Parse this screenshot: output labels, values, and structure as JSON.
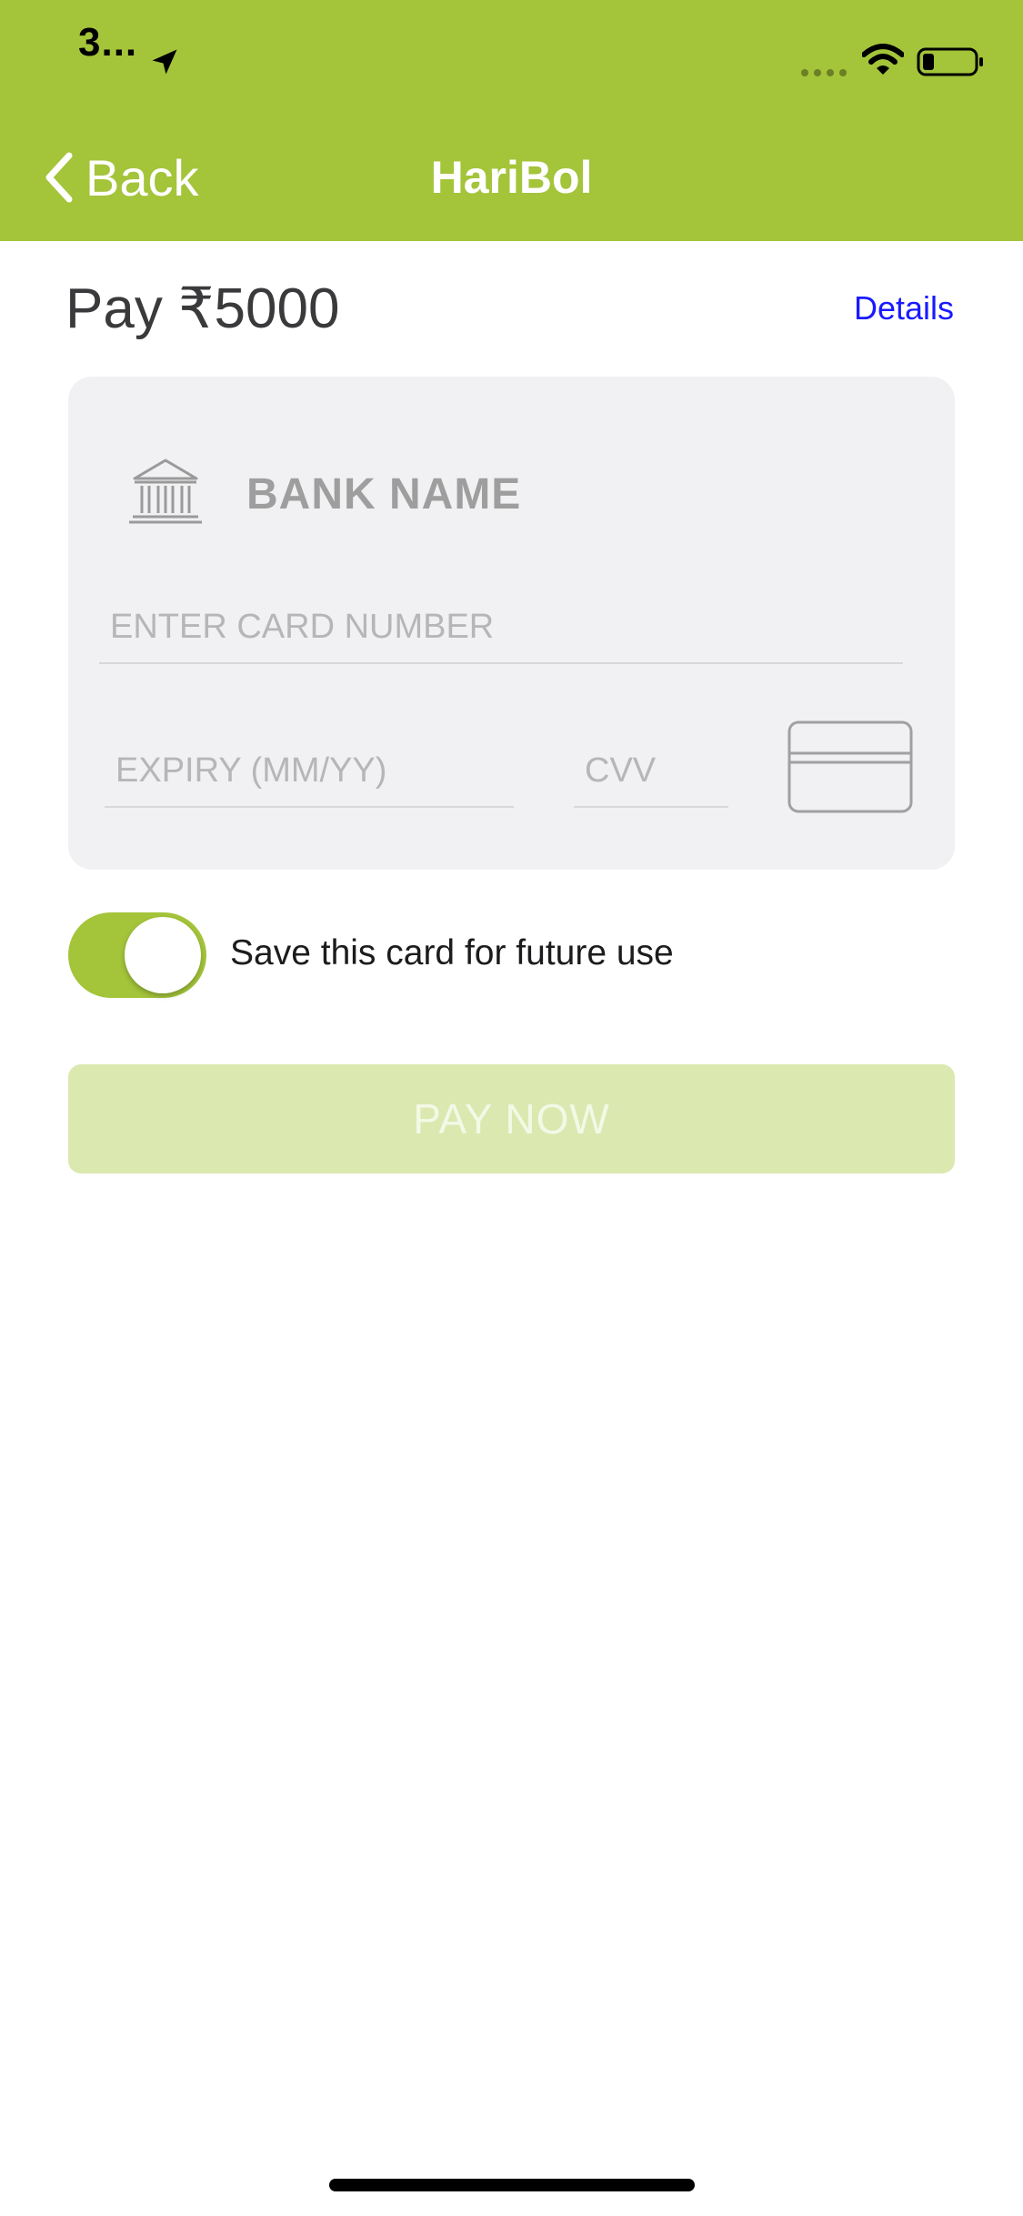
{
  "status_bar": {
    "time": "3...",
    "location_icon": "location-arrow-icon",
    "signal_icon": "signal-dots-icon",
    "wifi_icon": "wifi-icon",
    "battery_icon": "battery-low-icon"
  },
  "nav": {
    "back_label": "Back",
    "title": "HariBol",
    "color": "#a4c43a"
  },
  "payment": {
    "amount_label": "Pay ₹5000",
    "details_label": "Details"
  },
  "card_form": {
    "bank_icon": "bank-icon",
    "bank_name": "BANK NAME",
    "card_number_placeholder": "ENTER CARD NUMBER",
    "card_number_value": "",
    "expiry_placeholder": "EXPIRY (MM/YY)",
    "expiry_value": "",
    "cvv_placeholder": "CVV",
    "cvv_value": "",
    "card_icon": "credit-card-icon"
  },
  "save_card": {
    "label": "Save this card for future use",
    "enabled": true
  },
  "pay_button": {
    "label": "PAY NOW",
    "disabled": true
  }
}
